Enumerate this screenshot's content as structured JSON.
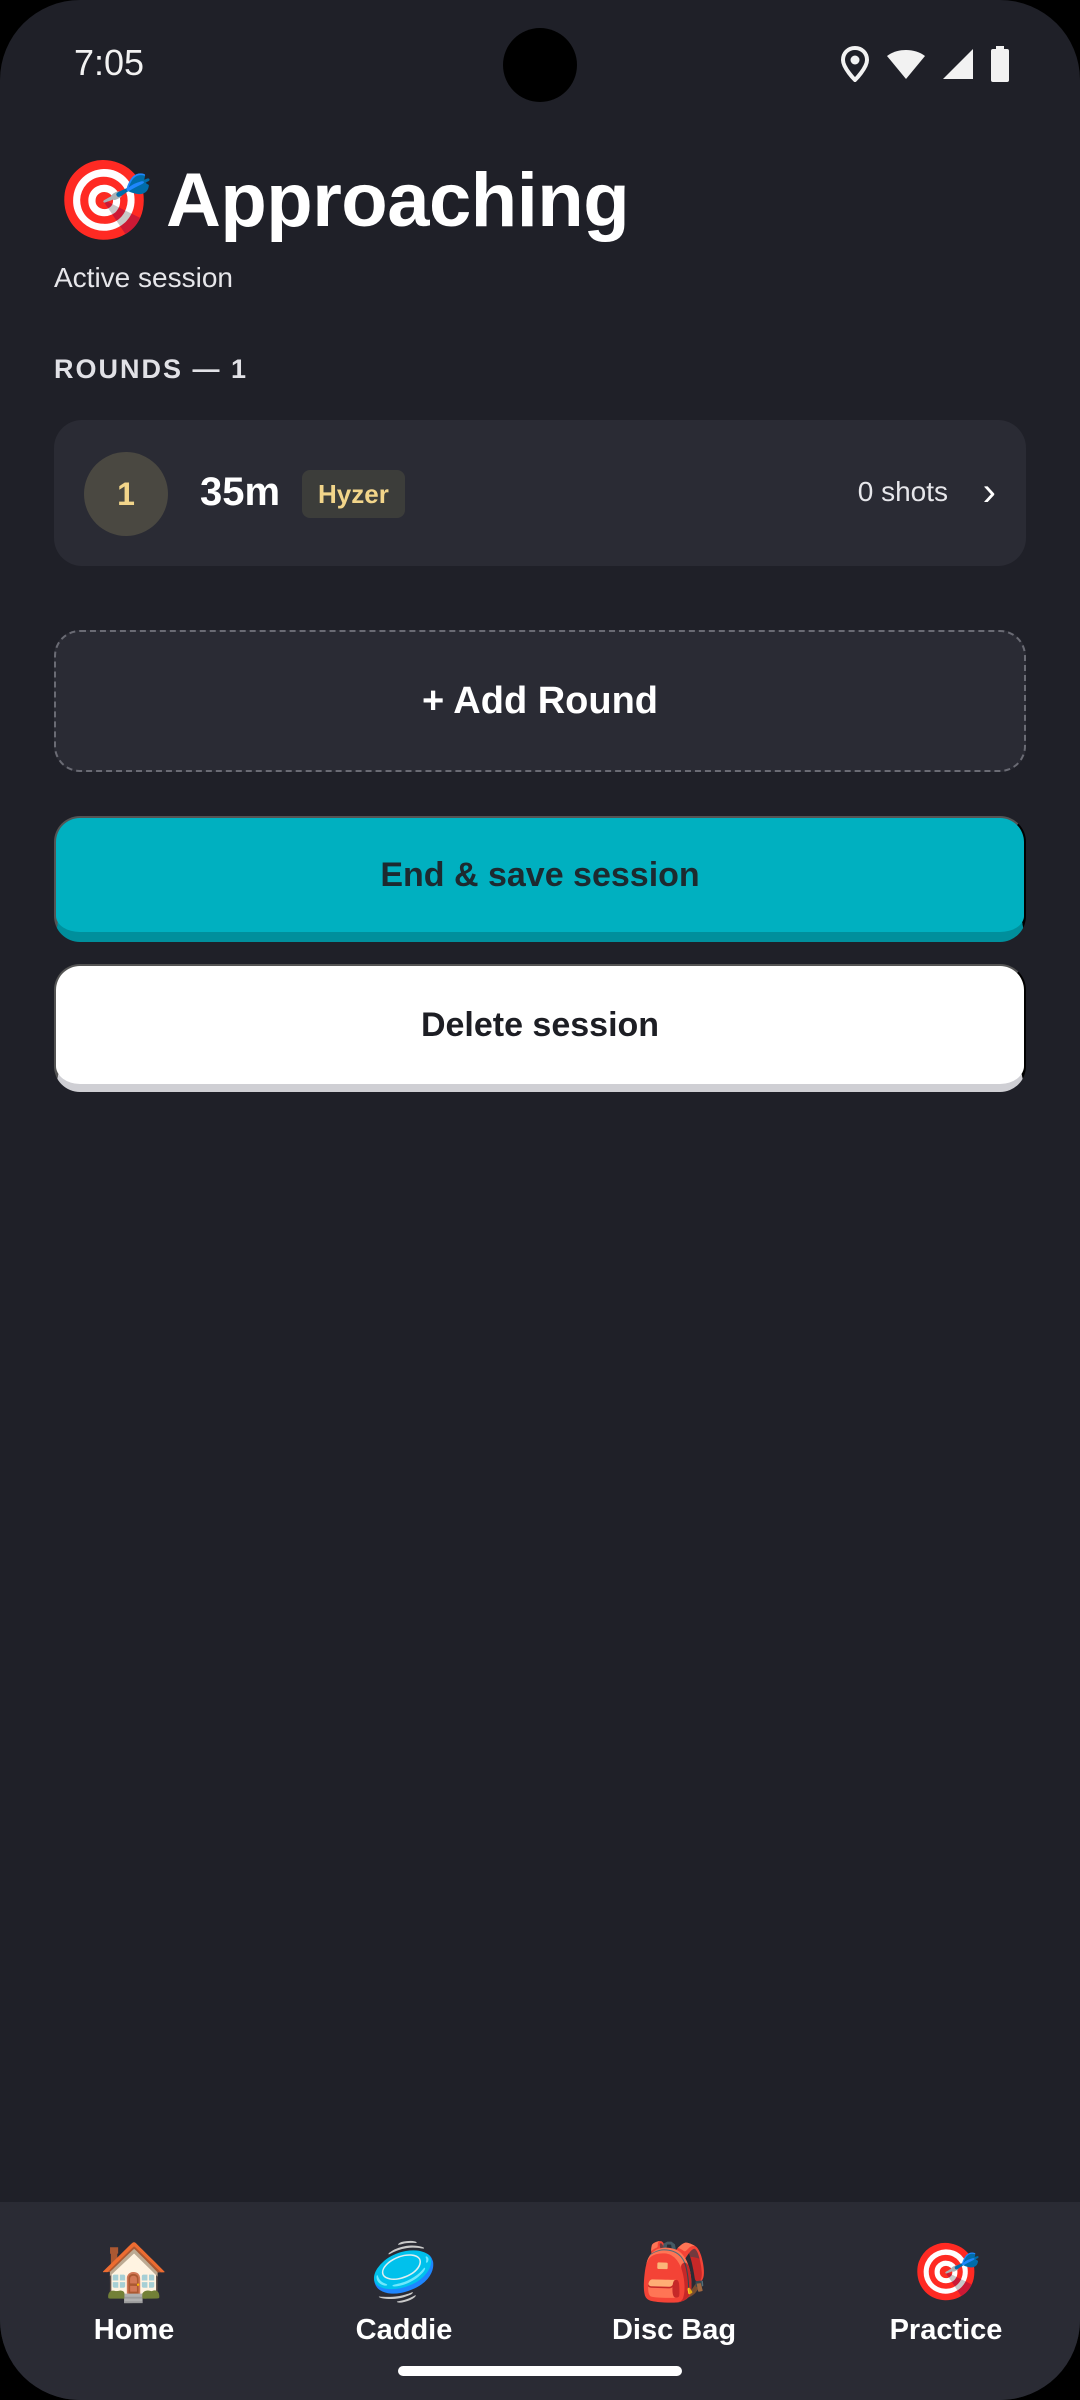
{
  "status_bar": {
    "time": "7:05",
    "icons": [
      "location-icon",
      "wifi-icon",
      "signal-icon",
      "battery-icon"
    ]
  },
  "header": {
    "title_icon": "🎯",
    "title": "Approaching",
    "subtitle": "Active session"
  },
  "rounds": {
    "section_label": "ROUNDS — 1",
    "items": [
      {
        "number": "1",
        "distance": "35m",
        "throw_type": "Hyzer",
        "shots": "0 shots",
        "chevron": "›"
      }
    ]
  },
  "actions": {
    "add_round": "+ Add Round",
    "end_save": "End & save session",
    "delete": "Delete session"
  },
  "bottom_nav": {
    "items": [
      {
        "icon": "🏠",
        "label": "Home"
      },
      {
        "icon": "🥏",
        "label": "Caddie"
      },
      {
        "icon": "🎒",
        "label": "Disc Bag"
      },
      {
        "icon": "🎯",
        "label": "Practice"
      }
    ]
  },
  "colors": {
    "background": "#1f2028",
    "card": "#2a2b34",
    "accent": "#00b0c0",
    "badge_text": "#f2d58a"
  }
}
